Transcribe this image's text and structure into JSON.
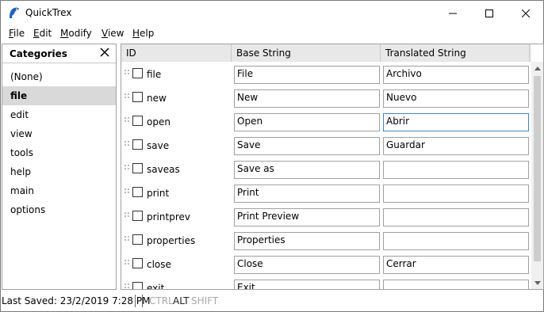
{
  "window": {
    "title": "QuickTrex"
  },
  "menu": {
    "file": "File",
    "edit": "Edit",
    "modify": "Modify",
    "view": "View",
    "help": "Help"
  },
  "sidebar": {
    "title": "Categories",
    "items": [
      {
        "label": "(None)",
        "selected": false
      },
      {
        "label": "file",
        "selected": true
      },
      {
        "label": "edit",
        "selected": false
      },
      {
        "label": "view",
        "selected": false
      },
      {
        "label": "tools",
        "selected": false
      },
      {
        "label": "help",
        "selected": false
      },
      {
        "label": "main",
        "selected": false
      },
      {
        "label": "options",
        "selected": false
      }
    ]
  },
  "grid": {
    "columns": {
      "id": "ID",
      "base": "Base String",
      "translated": "Translated String"
    },
    "rows": [
      {
        "id": "file",
        "base": "File",
        "translated": "Archivo",
        "checked": false
      },
      {
        "id": "new",
        "base": "New",
        "translated": "Nuevo",
        "checked": false
      },
      {
        "id": "open",
        "base": "Open",
        "translated": "Abrir",
        "checked": false,
        "focused": true
      },
      {
        "id": "save",
        "base": "Save",
        "translated": "Guardar",
        "checked": false
      },
      {
        "id": "saveas",
        "base": "Save as",
        "translated": "",
        "checked": false
      },
      {
        "id": "print",
        "base": "Print",
        "translated": "",
        "checked": false
      },
      {
        "id": "printprev",
        "base": "Print Preview",
        "translated": "",
        "checked": false
      },
      {
        "id": "properties",
        "base": "Properties",
        "translated": "",
        "checked": false
      },
      {
        "id": "close",
        "base": "Close",
        "translated": "Cerrar",
        "checked": false
      },
      {
        "id": "exit",
        "base": "Exit",
        "translated": "",
        "checked": false
      }
    ]
  },
  "status": {
    "last_saved": "Last Saved: 23/2/2019 7:28 PM",
    "ctrl": "CTRL",
    "alt": "ALT",
    "shift": "SHIFT",
    "alt_active": true
  },
  "colors": {
    "selected_bg": "#d9d9d9",
    "header_bg": "#e8e8e8",
    "focus_border": "#4a7fc1",
    "app_icon": "#1f5fbf"
  }
}
